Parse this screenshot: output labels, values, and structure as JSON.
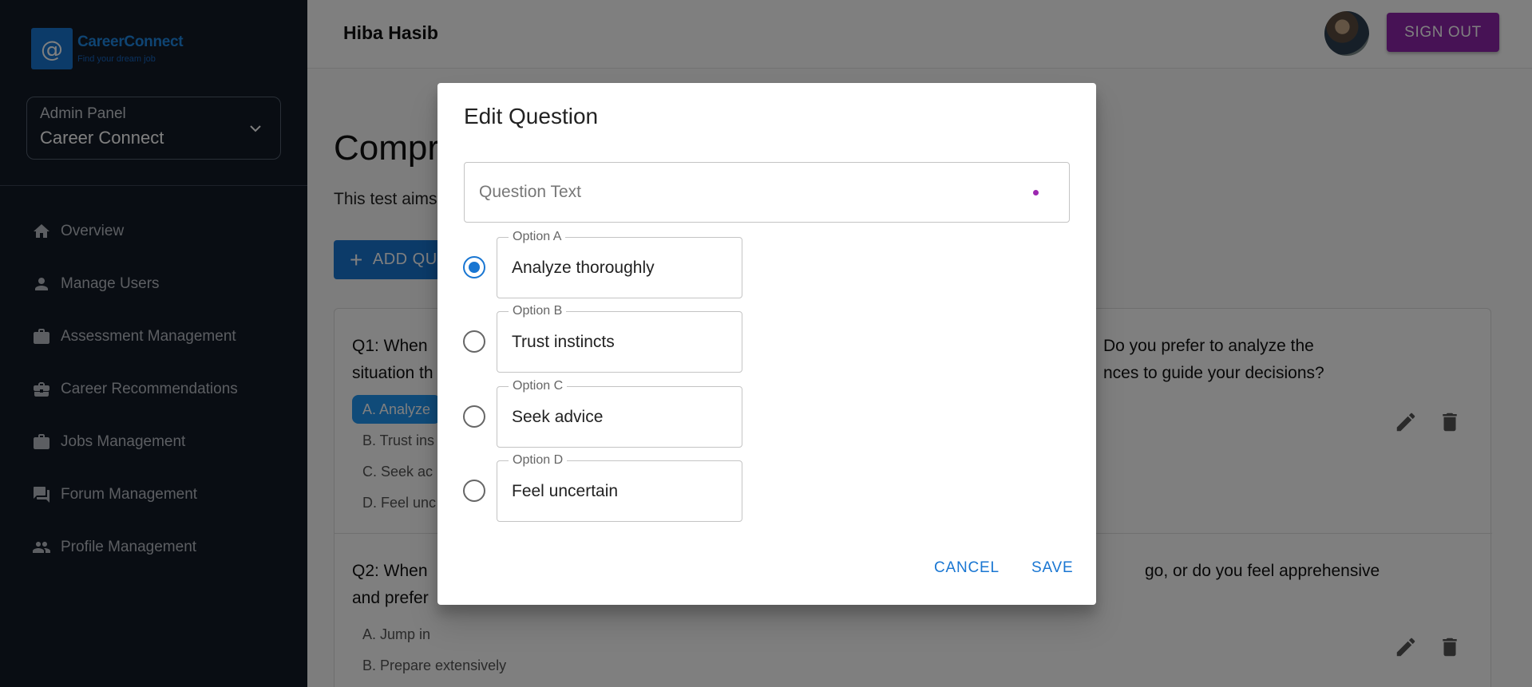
{
  "sidebar": {
    "logo": {
      "title": "CareerConnect",
      "subtitle": "Find your dream job",
      "mark": "@"
    },
    "panel": {
      "label": "Admin Panel",
      "value": "Career Connect"
    },
    "items": [
      {
        "label": "Overview",
        "icon": "home-icon"
      },
      {
        "label": "Manage Users",
        "icon": "person-icon"
      },
      {
        "label": "Assessment Management",
        "icon": "briefcase-icon"
      },
      {
        "label": "Career Recommendations",
        "icon": "business-center-icon"
      },
      {
        "label": "Jobs Management",
        "icon": "work-icon"
      },
      {
        "label": "Forum Management",
        "icon": "forum-icon"
      },
      {
        "label": "Profile Management",
        "icon": "people-icon"
      }
    ]
  },
  "header": {
    "user_name": "Hiba Hasib",
    "signout_label": "SIGN OUT"
  },
  "main": {
    "title": "Compr",
    "description": "This test aims",
    "add_button": "ADD QU",
    "questions": [
      {
        "line1_left": "Q1: When",
        "line1_right": "Do you prefer to analyze the",
        "line2_left": "situation th",
        "line2_right": "nces to guide your decisions?",
        "options": [
          "A. Analyze",
          "B. Trust ins",
          "C. Seek ac",
          "D. Feel unc"
        ]
      },
      {
        "line1_left": "Q2: When",
        "line1_right": "go, or do you feel apprehensive",
        "line2_left": "and prefer",
        "line2_right": "",
        "options": [
          "A. Jump in",
          "B. Prepare extensively"
        ]
      }
    ]
  },
  "dialog": {
    "title": "Edit Question",
    "question_placeholder": "Question Text",
    "selected_option": "A",
    "options": [
      {
        "label": "Option A",
        "value": "Analyze thoroughly"
      },
      {
        "label": "Option B",
        "value": "Trust instincts"
      },
      {
        "label": "Option C",
        "value": "Seek advice"
      },
      {
        "label": "Option D",
        "value": "Feel uncertain"
      }
    ],
    "cancel_label": "CANCEL",
    "save_label": "SAVE"
  },
  "colors": {
    "sidebar_bg": "#131a26",
    "primary": "#1976d2",
    "signout": "#8e24aa",
    "focus_dot": "#9c27b0"
  }
}
